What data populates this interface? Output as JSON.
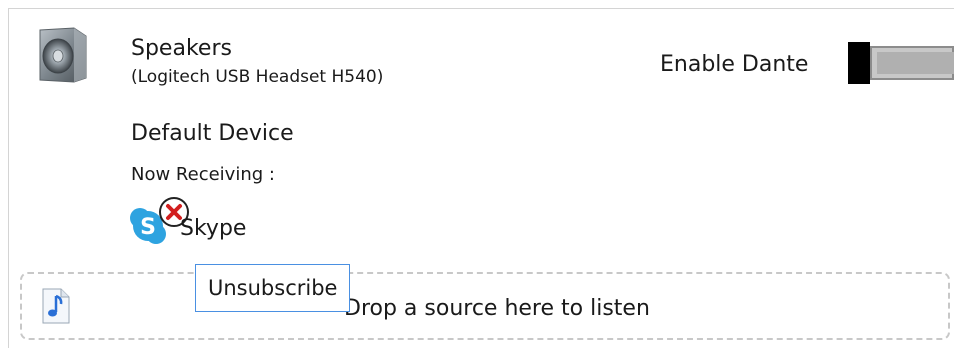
{
  "device": {
    "name": "Speakers",
    "subtitle": "(Logitech USB Headset H540)",
    "icon": "speaker-icon",
    "enable_label": "Enable Dante",
    "enable_state": "off",
    "status": "Default Device"
  },
  "receiving": {
    "label": "Now Receiving :",
    "sources": [
      {
        "name": "Skype",
        "icon": "skype-icon",
        "remove_icon": "remove-icon"
      }
    ]
  },
  "drop_zone": {
    "icon": "music-note-icon",
    "text": "Drop a source here to listen"
  },
  "tooltip": {
    "text": "Unsubscribe"
  },
  "colors": {
    "tooltip_border": "#4a90e2",
    "skype_blue": "#2ea3e0",
    "remove_red": "#d21f1f",
    "toggle_knob": "#000000",
    "toggle_track": "#c8c8c8",
    "dashed_border": "#c8c8c8"
  }
}
